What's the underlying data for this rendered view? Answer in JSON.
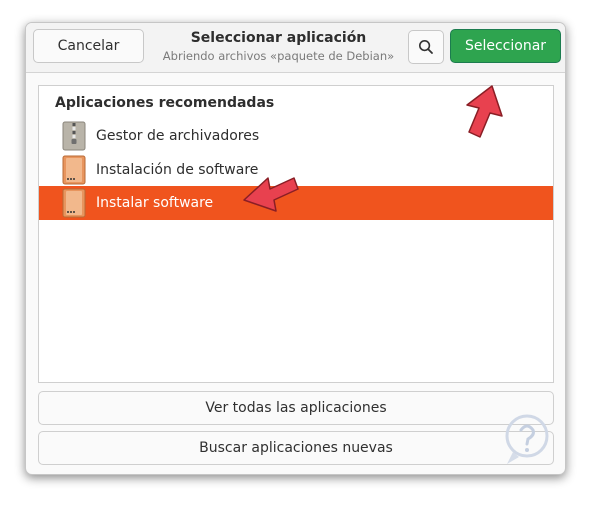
{
  "header": {
    "cancel_label": "Cancelar",
    "title": "Seleccionar aplicación",
    "subtitle": "Abriendo archivos «paquete de Debian»",
    "select_label": "Seleccionar",
    "search_icon": "search-icon"
  },
  "list": {
    "section_title": "Aplicaciones recomendadas",
    "items": [
      {
        "label": "Gestor de archivadores",
        "icon": "archive-manager-icon",
        "selected": false
      },
      {
        "label": "Instalación de software",
        "icon": "package-icon",
        "selected": false
      },
      {
        "label": "Instalar software",
        "icon": "package-icon",
        "selected": true
      }
    ]
  },
  "footer": {
    "view_all_label": "Ver todas las aplicaciones",
    "find_new_label": "Buscar aplicaciones nuevas"
  },
  "colors": {
    "accent_selected": "#f0541e",
    "select_button": "#2ea44f",
    "annotation_arrow": "#e8414f"
  }
}
